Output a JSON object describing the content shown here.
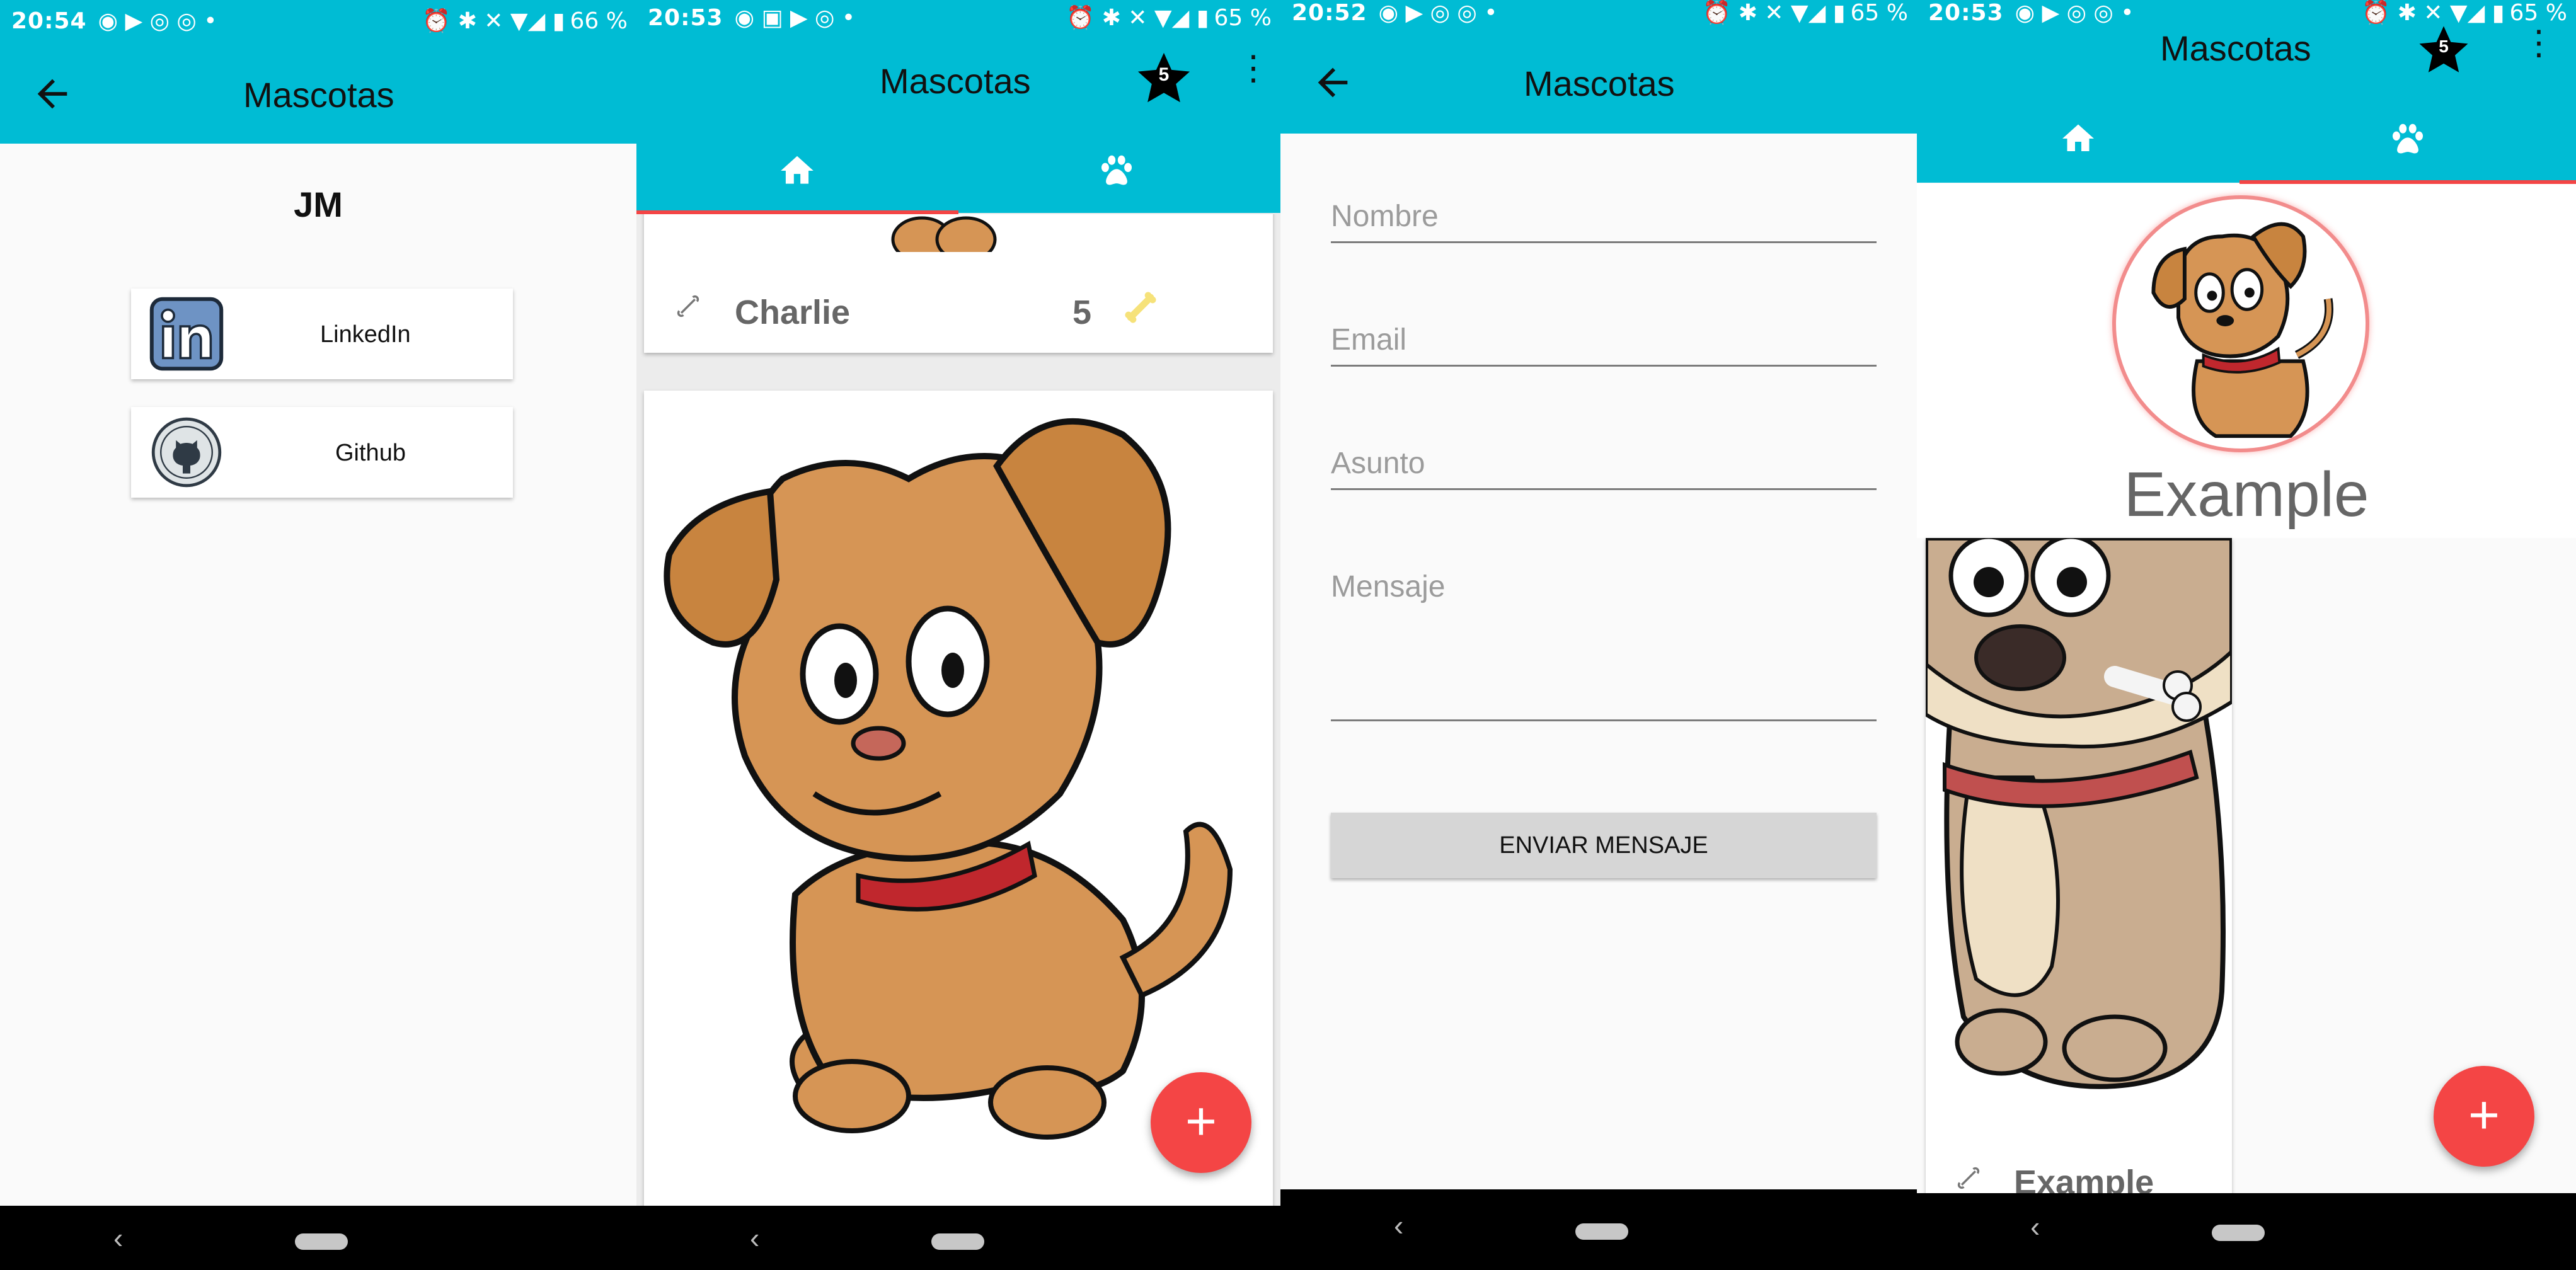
{
  "colors": {
    "primary": "#00BCD4",
    "accent": "#F44545",
    "background": "#FAFAFA"
  },
  "panel1": {
    "status": {
      "time": "20:54",
      "battery": "66 %"
    },
    "toolbar": {
      "title": "Mascotas"
    },
    "author": "JM",
    "links": [
      {
        "label": "LinkedIn",
        "icon": "linkedin-icon"
      },
      {
        "label": "Github",
        "icon": "github-icon"
      }
    ]
  },
  "panel2": {
    "status": {
      "time": "20:53",
      "battery": "65 %"
    },
    "toolbar": {
      "title": "Mascotas",
      "badge": "5"
    },
    "tabs": [
      {
        "icon": "home-icon"
      },
      {
        "icon": "paw-icon"
      }
    ],
    "pets": [
      {
        "name": "Charlie",
        "likes": "5"
      }
    ],
    "fab": "+"
  },
  "panel3": {
    "status": {
      "time": "20:52",
      "battery": "65 %"
    },
    "toolbar": {
      "title": "Mascotas"
    },
    "form": {
      "name_placeholder": "Nombre",
      "email_placeholder": "Email",
      "subject_placeholder": "Asunto",
      "message_placeholder": "Mensaje",
      "send_label": "ENVIAR MENSAJE"
    }
  },
  "panel4": {
    "status": {
      "time": "20:53",
      "battery": "65 %"
    },
    "toolbar": {
      "title": "Mascotas",
      "badge": "5"
    },
    "tabs": [
      {
        "icon": "home-icon"
      },
      {
        "icon": "paw-icon"
      }
    ],
    "profile_name": "Example",
    "pets": [
      {
        "name": "Example"
      }
    ],
    "fab": "+"
  }
}
